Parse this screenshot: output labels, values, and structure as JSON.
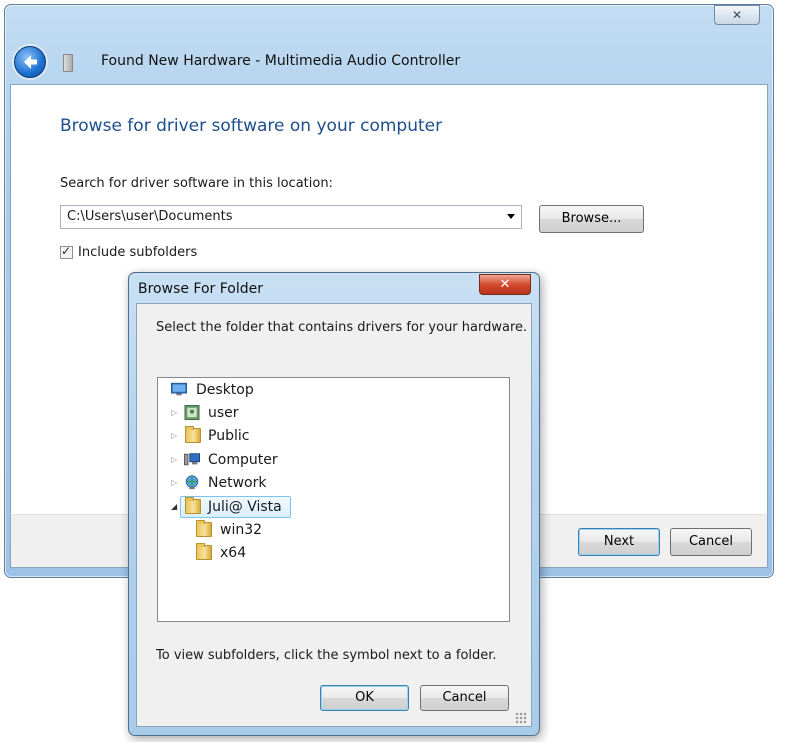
{
  "wizard": {
    "close_label": "✕",
    "title": "Found New Hardware - Multimedia Audio Controller",
    "heading": "Browse for driver software on your computer",
    "search_label": "Search for driver software in this location:",
    "path_value": "C:\\Users\\user\\Documents",
    "browse_label": "Browse...",
    "include_subfolders_label": "Include subfolders",
    "include_subfolders_checked": true,
    "next_label": "Next",
    "cancel_label": "Cancel"
  },
  "browse_dialog": {
    "title": "Browse For Folder",
    "close_label": "✕",
    "instruction": "Select the folder that contains drivers for your hardware.",
    "tree": [
      {
        "label": "Desktop",
        "icon": "desktop-icon",
        "expander": ""
      },
      {
        "label": "user",
        "icon": "user-folder-icon",
        "expander": "▷"
      },
      {
        "label": "Public",
        "icon": "folder-icon",
        "expander": "▷"
      },
      {
        "label": "Computer",
        "icon": "computer-icon",
        "expander": "▷"
      },
      {
        "label": "Network",
        "icon": "network-icon",
        "expander": "▷"
      },
      {
        "label": "Juli@ Vista",
        "icon": "folder-icon",
        "expander": "◢",
        "selected": true
      },
      {
        "label": "win32",
        "icon": "folder-icon",
        "expander": ""
      },
      {
        "label": "x64",
        "icon": "folder-icon",
        "expander": ""
      }
    ],
    "hint": "To view subfolders, click the symbol next to a folder.",
    "ok_label": "OK",
    "cancel_label": "Cancel"
  },
  "colors": {
    "heading": "#1e4e8c",
    "chrome": "#a9cbea",
    "close_red": "#d1462a"
  }
}
